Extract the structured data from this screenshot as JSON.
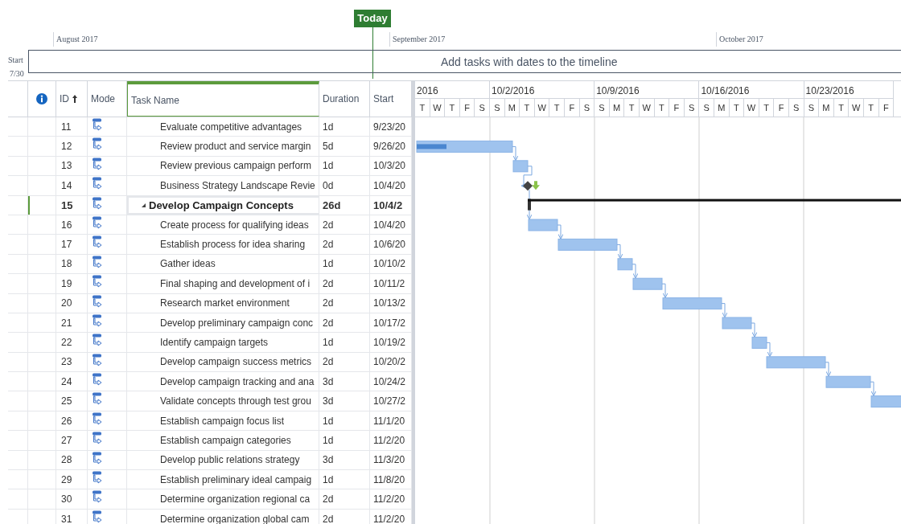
{
  "timeline": {
    "today_label": "Today",
    "months": [
      {
        "label": "August 2017"
      },
      {
        "label": "September 2017"
      },
      {
        "label": "October 2017"
      }
    ],
    "start_label": "Start",
    "start_date": "7/30",
    "placeholder": "Add tasks with dates to the timeline"
  },
  "columns": [
    {
      "label": "ID",
      "kind": "id",
      "sorted": true,
      "selected": false
    },
    {
      "label": "Mode",
      "kind": "mode",
      "sorted": false,
      "selected": false
    },
    {
      "label": "Task Name",
      "kind": "name",
      "sorted": false,
      "selected": true
    },
    {
      "label": "Duration",
      "kind": "duration",
      "sorted": false,
      "selected": false
    },
    {
      "label": "Start",
      "kind": "start",
      "sorted": false,
      "selected": false
    }
  ],
  "timescale": {
    "weeks": [
      {
        "label": "2016",
        "days": [
          "T",
          "W",
          "T",
          "F",
          "S"
        ]
      },
      {
        "label": "10/2/2016",
        "days": [
          "S",
          "M",
          "T",
          "W",
          "T",
          "F",
          "S"
        ]
      },
      {
        "label": "10/9/2016",
        "days": [
          "S",
          "M",
          "T",
          "W",
          "T",
          "F",
          "S"
        ]
      },
      {
        "label": "10/16/2016",
        "days": [
          "S",
          "M",
          "T",
          "W",
          "T",
          "F",
          "S"
        ]
      },
      {
        "label": "10/23/2016",
        "days": [
          "S",
          "M",
          "T",
          "W",
          "T",
          "F"
        ]
      }
    ]
  },
  "rows": [
    {
      "id": "11",
      "name": "Evaluate competitive advantages",
      "duration": "1d",
      "start": "9/23/20",
      "kind": "task",
      "selected": false
    },
    {
      "id": "12",
      "name": "Review product and service margin",
      "duration": "5d",
      "start": "9/26/20",
      "kind": "task",
      "selected": false
    },
    {
      "id": "13",
      "name": "Review previous campaign perform",
      "duration": "1d",
      "start": "10/3/20",
      "kind": "task",
      "selected": false
    },
    {
      "id": "14",
      "name": "Business Strategy Landscape Revie",
      "duration": "0d",
      "start": "10/4/20",
      "kind": "milestone",
      "selected": false
    },
    {
      "id": "15",
      "name": "Develop Campaign Concepts",
      "duration": "26d",
      "start": "10/4/2",
      "kind": "summary",
      "selected": true
    },
    {
      "id": "16",
      "name": "Create process for qualifying ideas",
      "duration": "2d",
      "start": "10/4/20",
      "kind": "task",
      "selected": false
    },
    {
      "id": "17",
      "name": "Establish process for idea sharing",
      "duration": "2d",
      "start": "10/6/20",
      "kind": "task",
      "selected": false
    },
    {
      "id": "18",
      "name": "Gather ideas",
      "duration": "1d",
      "start": "10/10/2",
      "kind": "task",
      "selected": false
    },
    {
      "id": "19",
      "name": "Final shaping and development of i",
      "duration": "2d",
      "start": "10/11/2",
      "kind": "task",
      "selected": false
    },
    {
      "id": "20",
      "name": "Research market environment",
      "duration": "2d",
      "start": "10/13/2",
      "kind": "task",
      "selected": false
    },
    {
      "id": "21",
      "name": "Develop preliminary campaign conc",
      "duration": "2d",
      "start": "10/17/2",
      "kind": "task",
      "selected": false
    },
    {
      "id": "22",
      "name": "Identify campaign targets",
      "duration": "1d",
      "start": "10/19/2",
      "kind": "task",
      "selected": false
    },
    {
      "id": "23",
      "name": "Develop campaign success metrics",
      "duration": "2d",
      "start": "10/20/2",
      "kind": "task",
      "selected": false
    },
    {
      "id": "24",
      "name": "Develop campaign tracking and ana",
      "duration": "3d",
      "start": "10/24/2",
      "kind": "task",
      "selected": false
    },
    {
      "id": "25",
      "name": "Validate concepts through test grou",
      "duration": "3d",
      "start": "10/27/2",
      "kind": "task",
      "selected": false
    },
    {
      "id": "26",
      "name": "Establish campaign focus list",
      "duration": "1d",
      "start": "11/1/20",
      "kind": "task",
      "selected": false
    },
    {
      "id": "27",
      "name": "Establish campaign categories",
      "duration": "1d",
      "start": "11/2/20",
      "kind": "task",
      "selected": false
    },
    {
      "id": "28",
      "name": "Develop public relations strategy",
      "duration": "3d",
      "start": "11/3/20",
      "kind": "task",
      "selected": false
    },
    {
      "id": "29",
      "name": "Establish preliminary ideal campaig",
      "duration": "1d",
      "start": "11/8/20",
      "kind": "task",
      "selected": false
    },
    {
      "id": "30",
      "name": "Determine organization regional ca",
      "duration": "2d",
      "start": "11/2/20",
      "kind": "task",
      "selected": false
    },
    {
      "id": "31",
      "name": "Determine organization global cam",
      "duration": "2d",
      "start": "11/2/20",
      "kind": "task",
      "selected": false
    }
  ]
}
